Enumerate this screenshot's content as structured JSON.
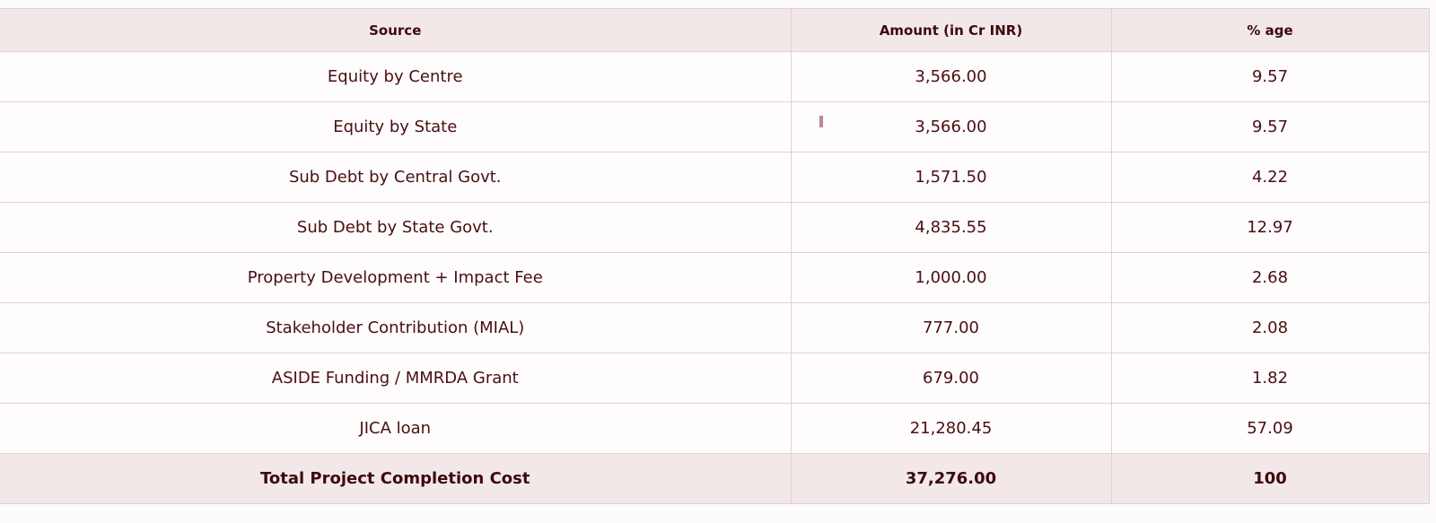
{
  "table": {
    "headers": {
      "source": "Source",
      "amount": "Amount (in Cr INR)",
      "percentage": "% age"
    },
    "rows": [
      {
        "source": "Equity by Centre",
        "amount": "3,566.00",
        "percentage": "9.57"
      },
      {
        "source": "Equity by State",
        "amount": "3,566.00",
        "percentage": "9.57"
      },
      {
        "source": "Sub Debt by Central Govt.",
        "amount": "1,571.50",
        "percentage": "4.22"
      },
      {
        "source": "Sub Debt by State Govt.",
        "amount": "4,835.55",
        "percentage": "12.97"
      },
      {
        "source": "Property Development + Impact Fee",
        "amount": "1,000.00",
        "percentage": "2.68"
      },
      {
        "source": "Stakeholder Contribution (MIAL)",
        "amount": "777.00",
        "percentage": "2.08"
      },
      {
        "source": "ASIDE Funding / MMRDA Grant",
        "amount": "679.00",
        "percentage": "1.82"
      },
      {
        "source": "JICA loan",
        "amount": "21,280.45",
        "percentage": "57.09"
      }
    ],
    "total": {
      "source": "Total Project Completion Cost",
      "amount": "37,276.00",
      "percentage": "100"
    }
  },
  "colors": {
    "header_background": "#f3e8e8",
    "text": "#4a0f12",
    "border": "#e3cfd2"
  }
}
